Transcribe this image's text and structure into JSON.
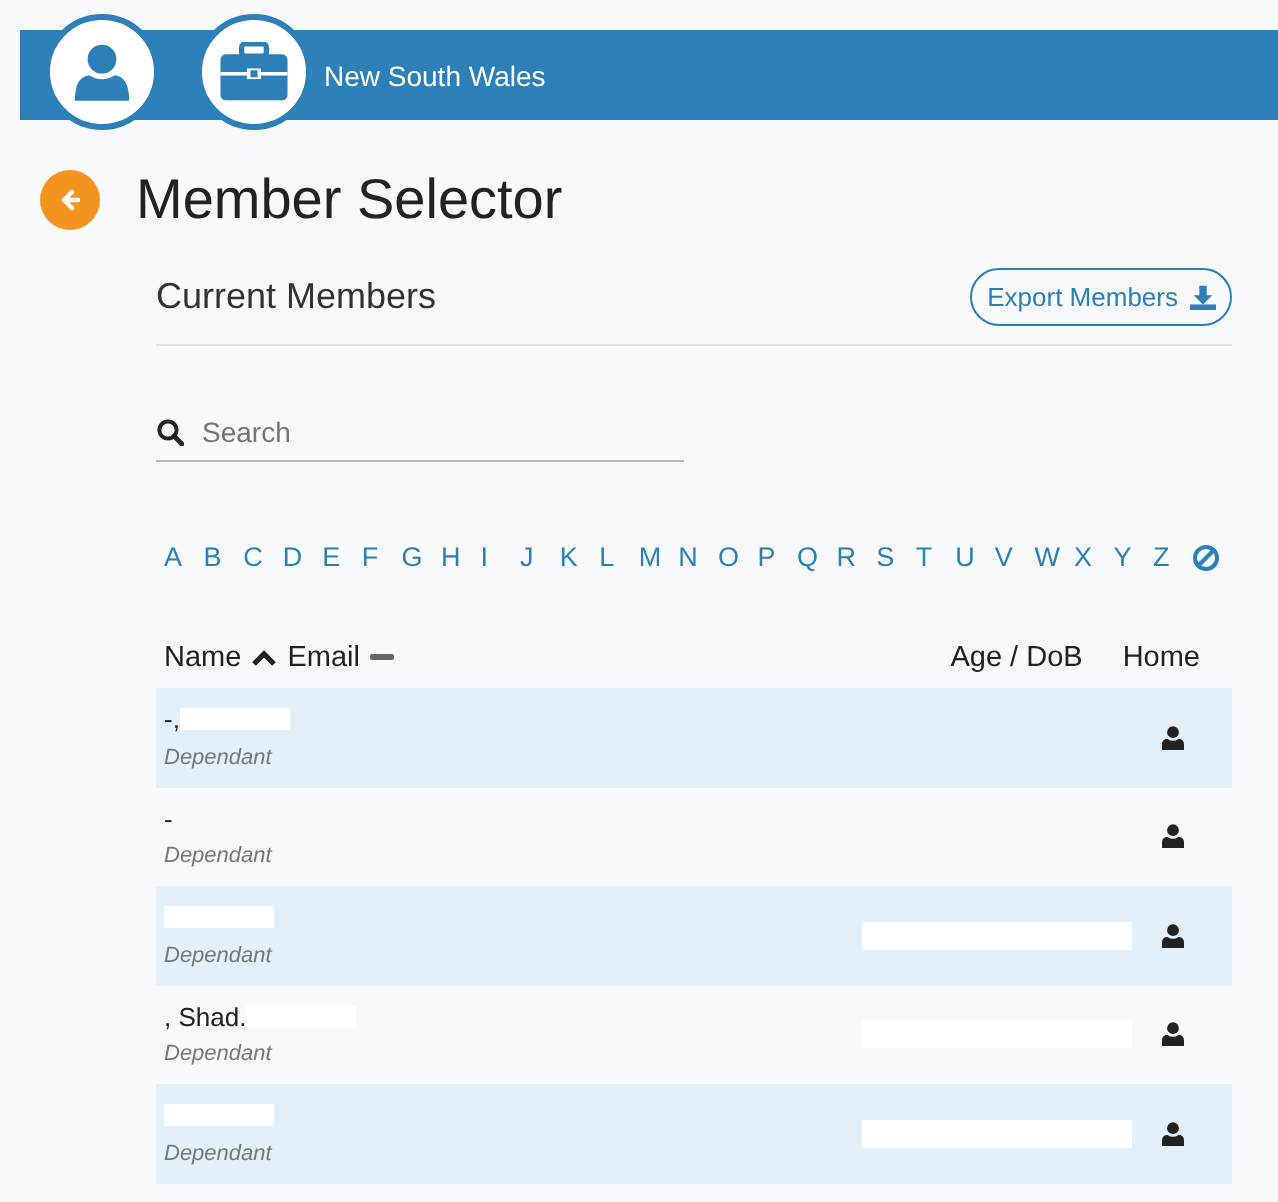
{
  "header": {
    "region": "New South Wales"
  },
  "page": {
    "title": "Member Selector"
  },
  "section": {
    "title": "Current Members",
    "export_button": "Export Members"
  },
  "search": {
    "placeholder": "Search"
  },
  "alphabet": [
    "A",
    "B",
    "C",
    "D",
    "E",
    "F",
    "G",
    "H",
    "I",
    "J",
    "K",
    "L",
    "M",
    "N",
    "O",
    "P",
    "Q",
    "R",
    "S",
    "T",
    "U",
    "V",
    "W",
    "X",
    "Y",
    "Z"
  ],
  "table": {
    "columns": [
      {
        "label": "Name",
        "sorted": true
      },
      {
        "label": "Email",
        "sorted": false
      },
      {
        "label": "Age / DoB"
      },
      {
        "label": "Home"
      }
    ],
    "rows": [
      {
        "name": "-,",
        "name_redacted": true,
        "role": "Dependant",
        "dob_redacted": false
      },
      {
        "name": "-",
        "name_redacted": false,
        "role": "Dependant",
        "dob_redacted": false
      },
      {
        "name_redacted": true,
        "role": "Dependant",
        "dob_redacted": true
      },
      {
        "name": ", Shad.",
        "name_redacted": true,
        "role": "Dependant",
        "dob_redacted": true
      },
      {
        "name_redacted": true,
        "role": "Dependant",
        "dob_redacted": true
      }
    ]
  }
}
